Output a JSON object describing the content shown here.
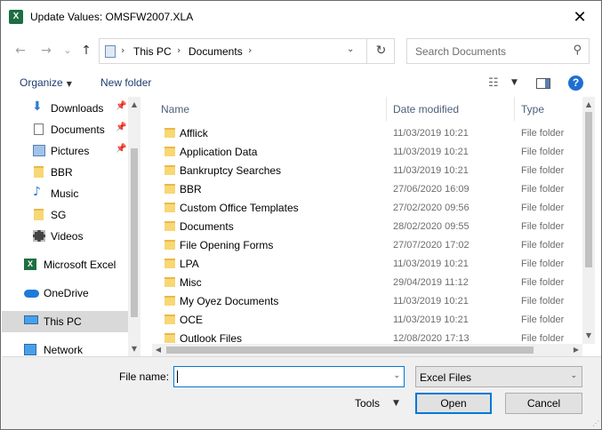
{
  "window": {
    "title": "Update Values: OMSFW2007.XLA",
    "close_label": "✕"
  },
  "nav": {
    "back": "←",
    "forward": "→",
    "recent": "⌄",
    "up": "↑"
  },
  "address": {
    "crumbs": [
      "This PC",
      "Documents"
    ],
    "separator": "›",
    "refresh": "↻"
  },
  "search": {
    "placeholder": "Search Documents"
  },
  "toolbar": {
    "organize": "Organize",
    "new_folder": "New folder",
    "help": "?"
  },
  "sidebar": {
    "items": [
      {
        "label": "Downloads",
        "icon": "download-icon",
        "pinned": true
      },
      {
        "label": "Documents",
        "icon": "documents-icon",
        "pinned": true
      },
      {
        "label": "Pictures",
        "icon": "pictures-icon",
        "pinned": true
      },
      {
        "label": "BBR",
        "icon": "folder-icon",
        "pinned": false
      },
      {
        "label": "Music",
        "icon": "music-icon",
        "pinned": false
      },
      {
        "label": "SG",
        "icon": "folder-icon",
        "pinned": false
      },
      {
        "label": "Videos",
        "icon": "videos-icon",
        "pinned": false
      },
      {
        "label": "Microsoft Excel",
        "icon": "excel-icon",
        "pinned": false
      },
      {
        "label": "OneDrive",
        "icon": "onedrive-icon",
        "pinned": false
      },
      {
        "label": "This PC",
        "icon": "this-pc-icon",
        "pinned": false,
        "selected": true
      },
      {
        "label": "Network",
        "icon": "network-icon",
        "pinned": false
      }
    ]
  },
  "columns": {
    "name": "Name",
    "date": "Date modified",
    "type": "Type"
  },
  "files": [
    {
      "name": "Afflick",
      "date": "11/03/2019 10:21",
      "type": "File folder"
    },
    {
      "name": "Application Data",
      "date": "11/03/2019 10:21",
      "type": "File folder"
    },
    {
      "name": "Bankruptcy Searches",
      "date": "11/03/2019 10:21",
      "type": "File folder"
    },
    {
      "name": "BBR",
      "date": "27/06/2020 16:09",
      "type": "File folder"
    },
    {
      "name": "Custom Office Templates",
      "date": "27/02/2020 09:56",
      "type": "File folder"
    },
    {
      "name": "Documents",
      "date": "28/02/2020 09:55",
      "type": "File folder"
    },
    {
      "name": "File Opening Forms",
      "date": "27/07/2020 17:02",
      "type": "File folder"
    },
    {
      "name": "LPA",
      "date": "11/03/2019 10:21",
      "type": "File folder"
    },
    {
      "name": "Misc",
      "date": "29/04/2019 11:12",
      "type": "File folder"
    },
    {
      "name": "My Oyez Documents",
      "date": "11/03/2019 10:21",
      "type": "File folder"
    },
    {
      "name": "OCE",
      "date": "11/03/2019 10:21",
      "type": "File folder"
    },
    {
      "name": "Outlook Files",
      "date": "12/08/2020 17:13",
      "type": "File folder"
    }
  ],
  "footer": {
    "file_name_label": "File name:",
    "file_name_value": "",
    "file_type": "Excel Files",
    "tools": "Tools",
    "open": "Open",
    "cancel": "Cancel"
  }
}
